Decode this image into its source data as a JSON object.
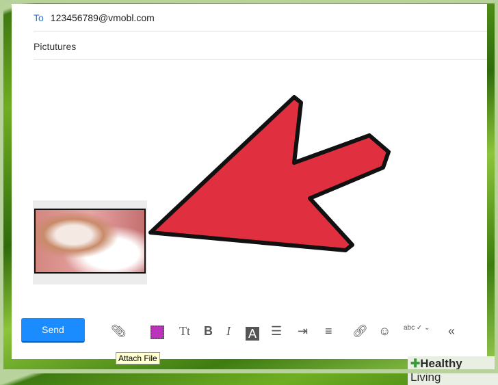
{
  "email": {
    "to_label": "To",
    "to_value": "123456789@vmobl.com",
    "subject": "Pictutures"
  },
  "toolbar": {
    "send_label": "Send",
    "tt": "Tt",
    "bold": "B",
    "italic": "I",
    "a": "A",
    "abc": "abc",
    "tooltip": "Attach File"
  },
  "watermark": {
    "bold": "Healthy",
    "light": " Living"
  },
  "colors": {
    "arrow": "#e03040",
    "send": "#1a8cff"
  }
}
